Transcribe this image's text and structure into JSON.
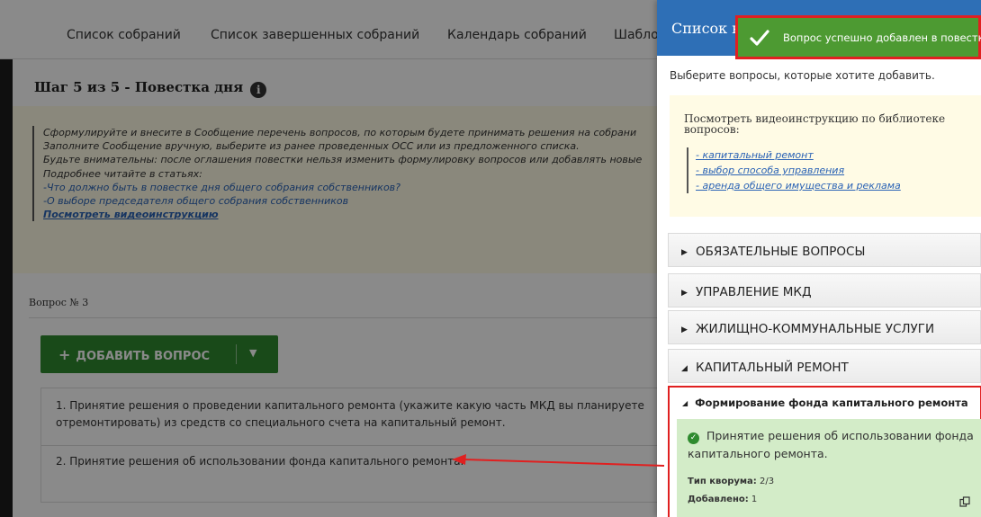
{
  "nav": {
    "items": [
      "Список собраний",
      "Список завершенных собраний",
      "Календарь собраний",
      "Шабло"
    ]
  },
  "step": {
    "title": "Шаг 5 из 5 - Повестка дня",
    "info_glyph": "i"
  },
  "hint": {
    "lines": [
      "Сформулируйте и внесите в Сообщение перечень вопросов, по которым будете принимать решения на собрани",
      "Заполните Сообщение вручную, выберите из ранее проведенных ОСС или из предложенного списка.",
      "Будьте внимательны: после оглашения повестки нельзя изменить формулировку вопросов или добавлять новые",
      "Подробнее читайте в статьях:"
    ],
    "link1": "-Что должно быть в повестке дня общего собрания собственников?",
    "link2": "-О выборе председателя общего собрания собственников",
    "video_link": "Посмотреть видеоинструкцию"
  },
  "question_no": "Вопрос № 3",
  "add_button": {
    "plus": "+",
    "label": "ДОБАВИТЬ ВОПРОС",
    "arrow": "▼"
  },
  "questions": [
    "1. Принятие решения о проведении капитального ремонта (укажите какую часть МКД вы планируете отремонтировать) из средств со специального счета на капитальный ремонт.",
    "2. Принятие решения об использовании фонда капитального ремонта."
  ],
  "panel": {
    "title": "Список в",
    "subtitle": "Выберите вопросы, которые хотите добавить.",
    "library": {
      "title": "Посмотреть видеоинструкцию по библиотеке вопросов:",
      "links": [
        "- капитальный ремонт",
        "- выбор способа управления",
        "- аренда общего имущества и реклама"
      ]
    },
    "categories": [
      {
        "label": "ОБЯЗАТЕЛЬНЫЕ ВОПРОСЫ",
        "marker": "▶"
      },
      {
        "label": "УПРАВЛЕНИЕ МКД",
        "marker": "▶"
      },
      {
        "label": "ЖИЛИЩНО-КОММУНАЛЬНЫЕ УСЛУГИ",
        "marker": "▶"
      },
      {
        "label": "КАПИТАЛЬНЫЙ РЕМОНТ",
        "marker": "◢"
      }
    ],
    "subcategory": {
      "title": "Формирование фонда капитального ремонта",
      "marker": "◢",
      "item": {
        "text": "Принятие решения об использовании фонда капитального ремонта.",
        "quorum_label": "Тип кворума:",
        "quorum_value": "2/3",
        "added_label": "Добавлено:",
        "added_value": "1"
      }
    }
  },
  "toast": {
    "message": "Вопрос успешно добавлен в повестку"
  },
  "colors": {
    "panel_header": "#2e6fb6",
    "toast_bg": "#4d9a32",
    "highlight_red": "#e02020",
    "add_button": "#2f8a2f",
    "added_bg": "#d3ecc8"
  },
  "icons": [
    "info-icon",
    "checkmark-icon",
    "check-circle-icon",
    "copy-icon",
    "chevron-down-icon",
    "plus-icon"
  ]
}
